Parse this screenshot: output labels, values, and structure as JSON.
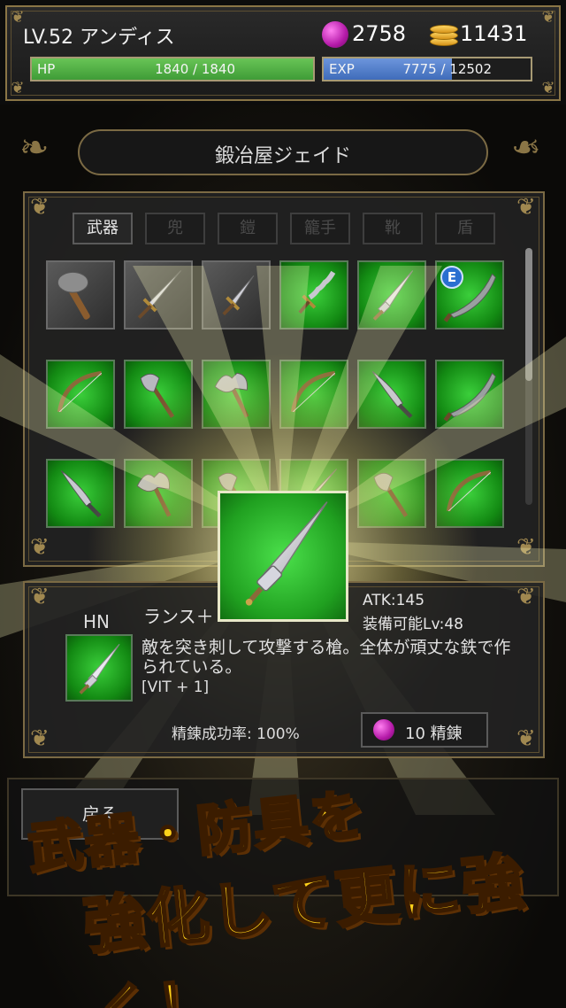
{
  "player": {
    "name": "LV.52 アンディス",
    "gems": "2758",
    "coins": "11431"
  },
  "hp": {
    "label": "HP",
    "value": "1840 / 1840",
    "fraction": 1.0
  },
  "exp": {
    "label": "EXP",
    "value": "7775 / 12502",
    "fraction": 0.62
  },
  "shop": {
    "title": "鍛冶屋ジェイド"
  },
  "tabs": [
    {
      "label": "武器",
      "active": true
    },
    {
      "label": "兜",
      "active": false
    },
    {
      "label": "鎧",
      "active": false
    },
    {
      "label": "籠手",
      "active": false
    },
    {
      "label": "靴",
      "active": false
    },
    {
      "label": "盾",
      "active": false
    }
  ],
  "items": [
    {
      "icon": "hammer-icon",
      "bg": "gray"
    },
    {
      "icon": "sword-icon",
      "bg": "gray"
    },
    {
      "icon": "dagger-icon",
      "bg": "gray"
    },
    {
      "icon": "wavy-sword-icon",
      "bg": "green"
    },
    {
      "icon": "lance-icon",
      "bg": "green"
    },
    {
      "icon": "scimitar-icon",
      "bg": "green",
      "badge": "E"
    },
    {
      "icon": "bow-icon",
      "bg": "green"
    },
    {
      "icon": "axe-icon",
      "bg": "green"
    },
    {
      "icon": "double-axe-icon",
      "bg": "green"
    },
    {
      "icon": "bow-icon",
      "bg": "green"
    },
    {
      "icon": "knife-icon",
      "bg": "green"
    },
    {
      "icon": "scimitar-icon",
      "bg": "green"
    },
    {
      "icon": "knife-icon",
      "bg": "green"
    },
    {
      "icon": "double-axe-icon",
      "bg": "green"
    },
    {
      "icon": "axe-icon",
      "bg": "green"
    },
    {
      "icon": "sword-icon",
      "bg": "green"
    },
    {
      "icon": "axe-icon",
      "bg": "green"
    },
    {
      "icon": "bow-icon",
      "bg": "green"
    }
  ],
  "detail": {
    "grade": "HN",
    "name": "ランス＋",
    "atk": "ATK:145",
    "required_level": "装備可能Lv:48",
    "description": "敵を突き刺して攻撃する槍。全体が頑丈な鉄で作られている。",
    "bonus": "[VIT + 1]",
    "success_rate": "精錬成功率: 100%",
    "refine_button": "10 精錬"
  },
  "back_button": "戻る",
  "promo": {
    "line1": "武器・防具を",
    "line2": "強化して更に強く！"
  },
  "colors": {
    "hp": "#4fae43",
    "exp": "#4f7fcc",
    "frame": "#7b6a44",
    "item_green": "#20a020",
    "promo_text": "#ffd21a"
  }
}
